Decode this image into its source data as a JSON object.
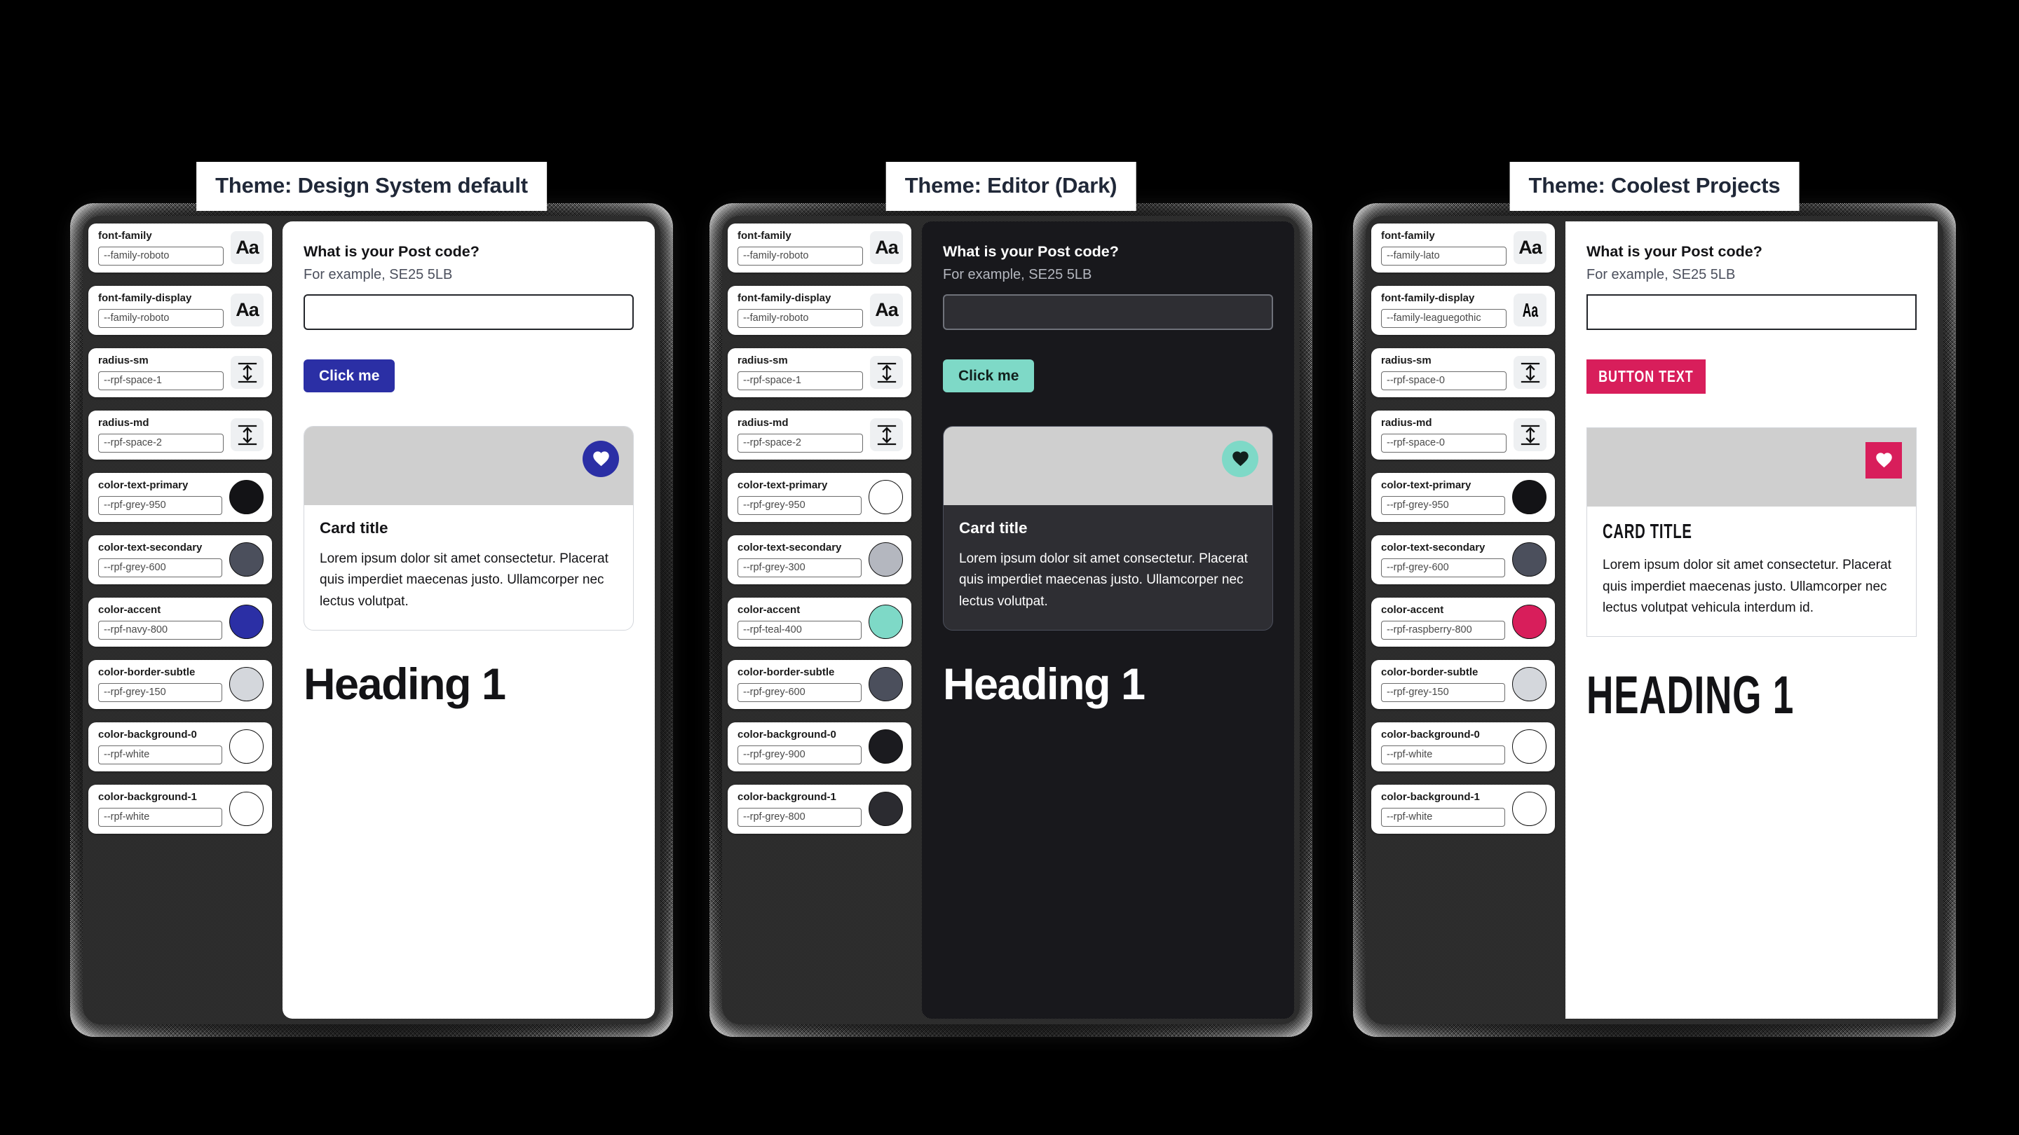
{
  "panels": [
    {
      "title": "Theme: Design System default",
      "tokens": [
        {
          "label": "font-family",
          "value": "--family-roboto",
          "icon": "font-aa-icon"
        },
        {
          "label": "font-family-display",
          "value": "--family-roboto",
          "icon": "font-aa-icon"
        },
        {
          "label": "radius-sm",
          "value": "--rpf-space-1",
          "icon": "spacing-arrow-icon"
        },
        {
          "label": "radius-md",
          "value": "--rpf-space-2",
          "icon": "spacing-arrow-icon"
        },
        {
          "label": "color-text-primary",
          "value": "--rpf-grey-950",
          "icon": "color-swatch",
          "swatch": "#131316"
        },
        {
          "label": "color-text-secondary",
          "value": "--rpf-grey-600",
          "icon": "color-swatch",
          "swatch": "#4b4f5c"
        },
        {
          "label": "color-accent",
          "value": "--rpf-navy-800",
          "icon": "color-swatch",
          "swatch": "#2b2fa5"
        },
        {
          "label": "color-border-subtle",
          "value": "--rpf-grey-150",
          "icon": "color-swatch",
          "swatch": "#d4d7dc"
        },
        {
          "label": "color-background-0",
          "value": "--rpf-white",
          "icon": "color-swatch",
          "swatch": "#ffffff"
        },
        {
          "label": "color-background-1",
          "value": "--rpf-white",
          "icon": "color-swatch",
          "swatch": "#ffffff"
        }
      ],
      "preview": {
        "question": "What is your Post code?",
        "hint": "For example, SE25 5LB",
        "field_value": "",
        "field_placeholder": "",
        "button_label": "Click me",
        "card_title": "Card title",
        "card_text": "Lorem ipsum dolor sit amet consectetur. Placerat quis imperdiet maecenas justo. Ullamcorper nec lectus volutpat.",
        "heading": "Heading 1",
        "badge_icon": "heart-icon"
      },
      "style": {
        "bg": "#ffffff",
        "surface": "#ffffff",
        "text": "#131316",
        "text2": "#4b4f5c",
        "accent": "#2b2fa5",
        "on_accent": "#ffffff",
        "border": "#d4d7dc",
        "field_border": "#24262b",
        "radius_sm": "6px",
        "radius_md": "14px",
        "badge_radius": "50%",
        "card_display": "normal"
      }
    },
    {
      "title": "Theme: Editor (Dark)",
      "tokens": [
        {
          "label": "font-family",
          "value": "--family-roboto",
          "icon": "font-aa-icon"
        },
        {
          "label": "font-family-display",
          "value": "--family-roboto",
          "icon": "font-aa-icon"
        },
        {
          "label": "radius-sm",
          "value": "--rpf-space-1",
          "icon": "spacing-arrow-icon"
        },
        {
          "label": "radius-md",
          "value": "--rpf-space-2",
          "icon": "spacing-arrow-icon"
        },
        {
          "label": "color-text-primary",
          "value": "--rpf-grey-950",
          "icon": "color-swatch",
          "swatch": "#ffffff"
        },
        {
          "label": "color-text-secondary",
          "value": "--rpf-grey-300",
          "icon": "color-swatch",
          "swatch": "#b4b7bf"
        },
        {
          "label": "color-accent",
          "value": "--rpf-teal-400",
          "icon": "color-swatch",
          "swatch": "#7ed9c7"
        },
        {
          "label": "color-border-subtle",
          "value": "--rpf-grey-600",
          "icon": "color-swatch",
          "swatch": "#4b4f5c"
        },
        {
          "label": "color-background-0",
          "value": "--rpf-grey-900",
          "icon": "color-swatch",
          "swatch": "#1b1b1f"
        },
        {
          "label": "color-background-1",
          "value": "--rpf-grey-800",
          "icon": "color-swatch",
          "swatch": "#2b2b30"
        }
      ],
      "preview": {
        "question": "What is your Post code?",
        "hint": "For example, SE25 5LB",
        "field_value": "",
        "field_placeholder": "",
        "button_label": "Click me",
        "card_title": "Card title",
        "card_text": "Lorem ipsum dolor sit amet consectetur. Placerat quis imperdiet maecenas justo. Ullamcorper nec lectus volutpat.",
        "heading": "Heading 1",
        "badge_icon": "heart-icon"
      },
      "style": {
        "bg": "#18181c",
        "surface": "#2e2e33",
        "text": "#ffffff",
        "text2": "#b4b7bf",
        "accent": "#7ed9c7",
        "on_accent": "#11201d",
        "border": "#4b4f5c",
        "field_border": "#6f727a",
        "radius_sm": "6px",
        "radius_md": "14px",
        "badge_radius": "50%",
        "card_display": "normal"
      }
    },
    {
      "title": "Theme: Coolest Projects",
      "tokens": [
        {
          "label": "font-family",
          "value": "--family-lato",
          "icon": "font-aa-icon"
        },
        {
          "label": "font-family-display",
          "value": "--family-leaguegothic",
          "icon": "font-aa-gothic-icon"
        },
        {
          "label": "radius-sm",
          "value": "--rpf-space-0",
          "icon": "spacing-arrow-icon"
        },
        {
          "label": "radius-md",
          "value": "--rpf-space-0",
          "icon": "spacing-arrow-icon"
        },
        {
          "label": "color-text-primary",
          "value": "--rpf-grey-950",
          "icon": "color-swatch",
          "swatch": "#131316"
        },
        {
          "label": "color-text-secondary",
          "value": "--rpf-grey-600",
          "icon": "color-swatch",
          "swatch": "#4b4f5c"
        },
        {
          "label": "color-accent",
          "value": "--rpf-raspberry-800",
          "icon": "color-swatch",
          "swatch": "#d81e5b"
        },
        {
          "label": "color-border-subtle",
          "value": "--rpf-grey-150",
          "icon": "color-swatch",
          "swatch": "#d4d7dc"
        },
        {
          "label": "color-background-0",
          "value": "--rpf-white",
          "icon": "color-swatch",
          "swatch": "#ffffff"
        },
        {
          "label": "color-background-1",
          "value": "--rpf-white",
          "icon": "color-swatch",
          "swatch": "#ffffff"
        }
      ],
      "preview": {
        "question": "What is your Post code?",
        "hint": "For example, SE25 5LB",
        "field_value": "",
        "field_placeholder": "",
        "button_label": "Button text",
        "card_title": "Card title",
        "card_text": "Lorem ipsum dolor sit amet consectetur. Placerat quis imperdiet maecenas justo. Ullamcorper nec lectus volutpat vehicula interdum id.",
        "heading": "Heading 1",
        "badge_icon": "heart-icon"
      },
      "style": {
        "bg": "#ffffff",
        "surface": "#ffffff",
        "text": "#131316",
        "text2": "#4b4f5c",
        "accent": "#d81e5b",
        "on_accent": "#ffffff",
        "border": "#d4d7dc",
        "field_border": "#24262b",
        "radius_sm": "0px",
        "radius_md": "0px",
        "badge_radius": "0px",
        "card_display": "gothic"
      }
    }
  ]
}
